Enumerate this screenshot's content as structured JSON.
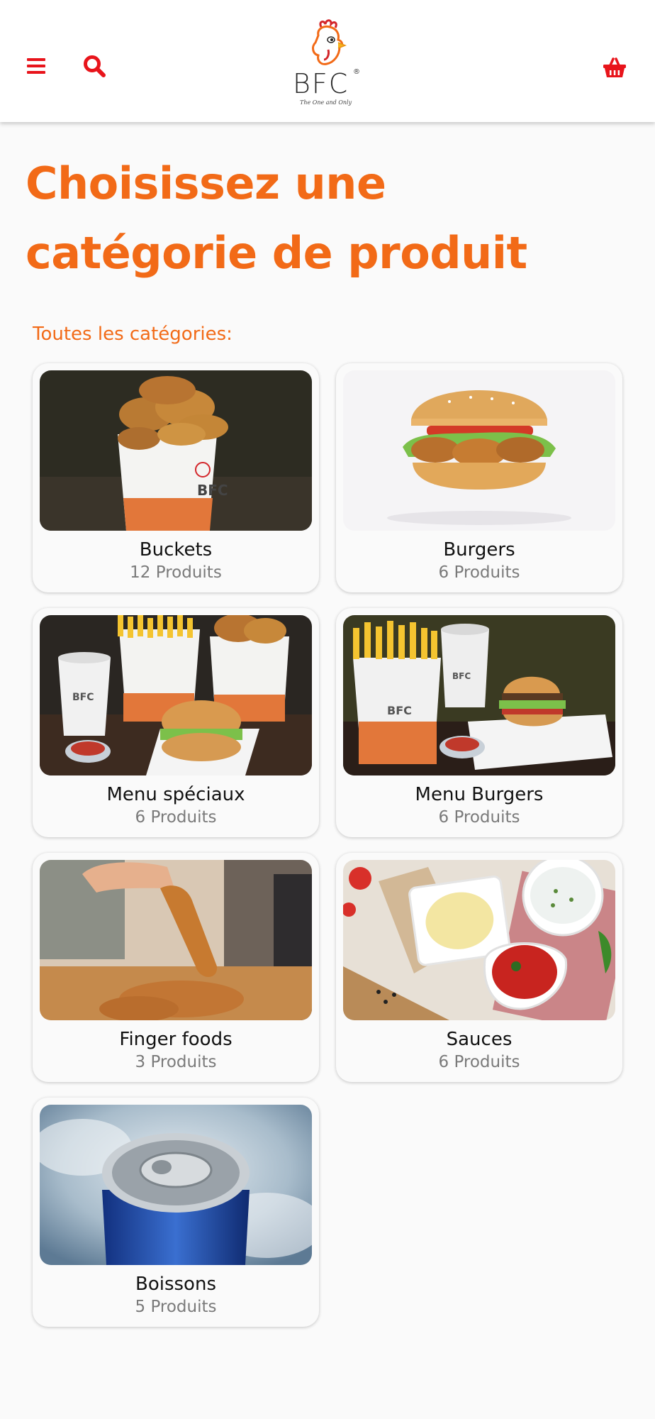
{
  "header": {
    "logo_text": "BFC",
    "logo_tagline": "The One and Only",
    "accent_color": "#e8141b",
    "icons": [
      "menu-icon",
      "search-icon",
      "basket-icon"
    ]
  },
  "title": "Choisissez une catégorie de produit",
  "section_label": "Toutes les catégories:",
  "brand_color": "#f26a17",
  "categories": [
    {
      "name": "Buckets",
      "count": "12 Produits",
      "image": "chicken-bucket-photo"
    },
    {
      "name": "Burgers",
      "count": "6 Produits",
      "image": "chicken-burger-photo"
    },
    {
      "name": "Menu spéciaux",
      "count": "6 Produits",
      "image": "special-menu-photo"
    },
    {
      "name": "Menu Burgers",
      "count": "6 Produits",
      "image": "burger-menu-photo"
    },
    {
      "name": "Finger foods",
      "count": "3 Produits",
      "image": "chicken-fingers-photo"
    },
    {
      "name": "Sauces",
      "count": "6 Produits",
      "image": "sauces-photo"
    },
    {
      "name": "Boissons",
      "count": "5 Produits",
      "image": "soda-can-photo"
    }
  ]
}
